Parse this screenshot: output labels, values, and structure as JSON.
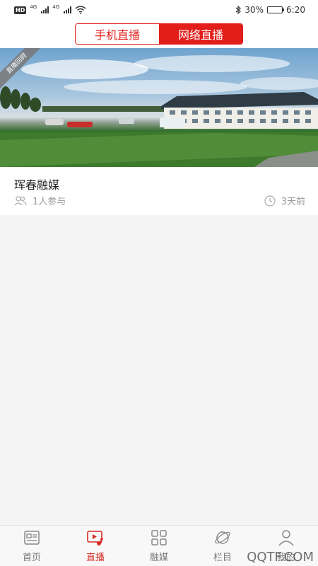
{
  "status_bar": {
    "hd": "HD",
    "sim1": "4G",
    "sim2": "4G",
    "battery": "30%",
    "battery_level": 0.3,
    "time": "6:20"
  },
  "header": {
    "tabs": [
      {
        "label": "手机直播",
        "active": false
      },
      {
        "label": "网络直播",
        "active": true
      }
    ]
  },
  "card": {
    "ribbon": "直播回顾",
    "title": "珲春融媒",
    "participants": "1人参与",
    "time_ago": "3天前"
  },
  "nav": {
    "items": [
      {
        "label": "首页",
        "icon": "news-icon",
        "active": false
      },
      {
        "label": "直播",
        "icon": "live-video-icon",
        "active": true
      },
      {
        "label": "融媒",
        "icon": "grid-icon",
        "active": false
      },
      {
        "label": "栏目",
        "icon": "planet-icon",
        "active": false
      },
      {
        "label": "我的",
        "icon": "user-icon",
        "active": false
      }
    ]
  },
  "colors": {
    "accent": "#e31d1a",
    "nav_active": "#d62b24",
    "nav_inactive": "#777777"
  },
  "watermark": "QQTF.COM"
}
